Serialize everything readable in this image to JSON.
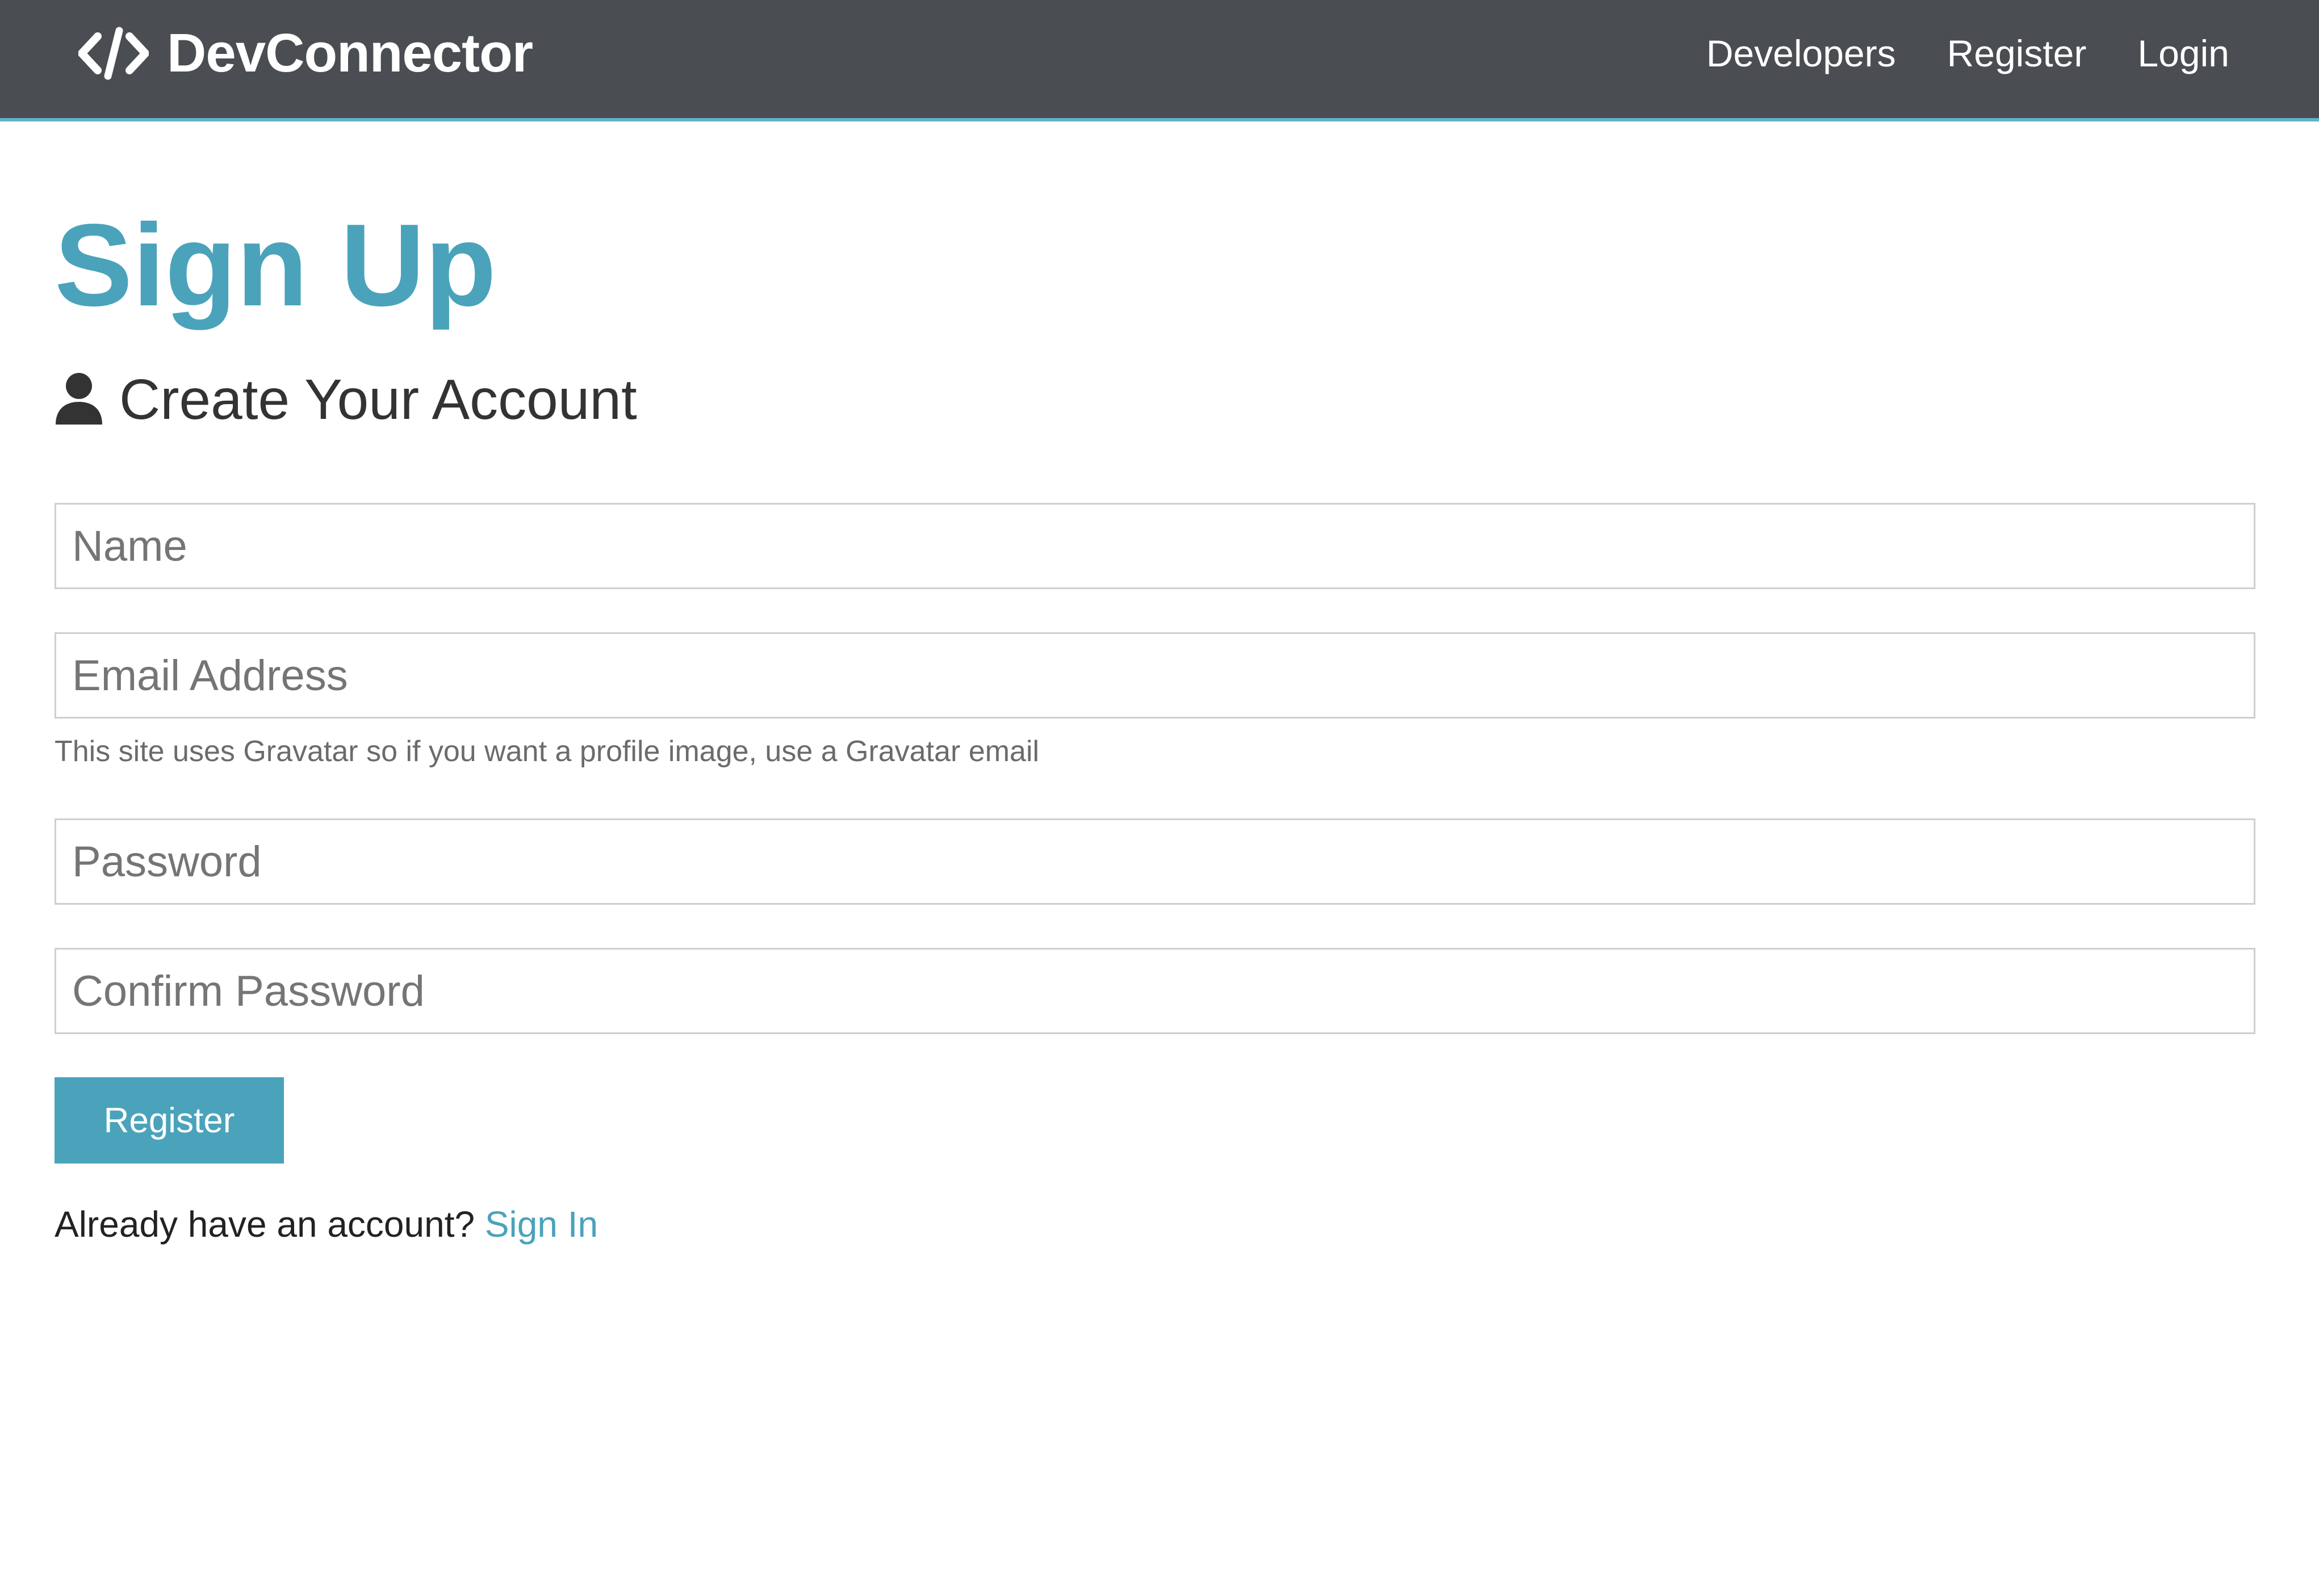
{
  "navbar": {
    "brand": "DevConnector",
    "links": [
      "Developers",
      "Register",
      "Login"
    ]
  },
  "main": {
    "title": "Sign Up",
    "lead": "Create Your Account",
    "form": {
      "name_placeholder": "Name",
      "email_placeholder": "Email Address",
      "email_hint": "This site uses Gravatar so if you want a profile image, use a Gravatar email",
      "password_placeholder": "Password",
      "confirm_password_placeholder": "Confirm Password",
      "submit_label": "Register"
    },
    "footer": {
      "prompt": "Already have an account?",
      "link": "Sign In"
    }
  },
  "colors": {
    "navbar_bg": "#4a4d52",
    "accent": "#4aa3bb",
    "text": "#333333"
  },
  "icons": {
    "brand": "code-icon",
    "lead": "user-icon"
  }
}
